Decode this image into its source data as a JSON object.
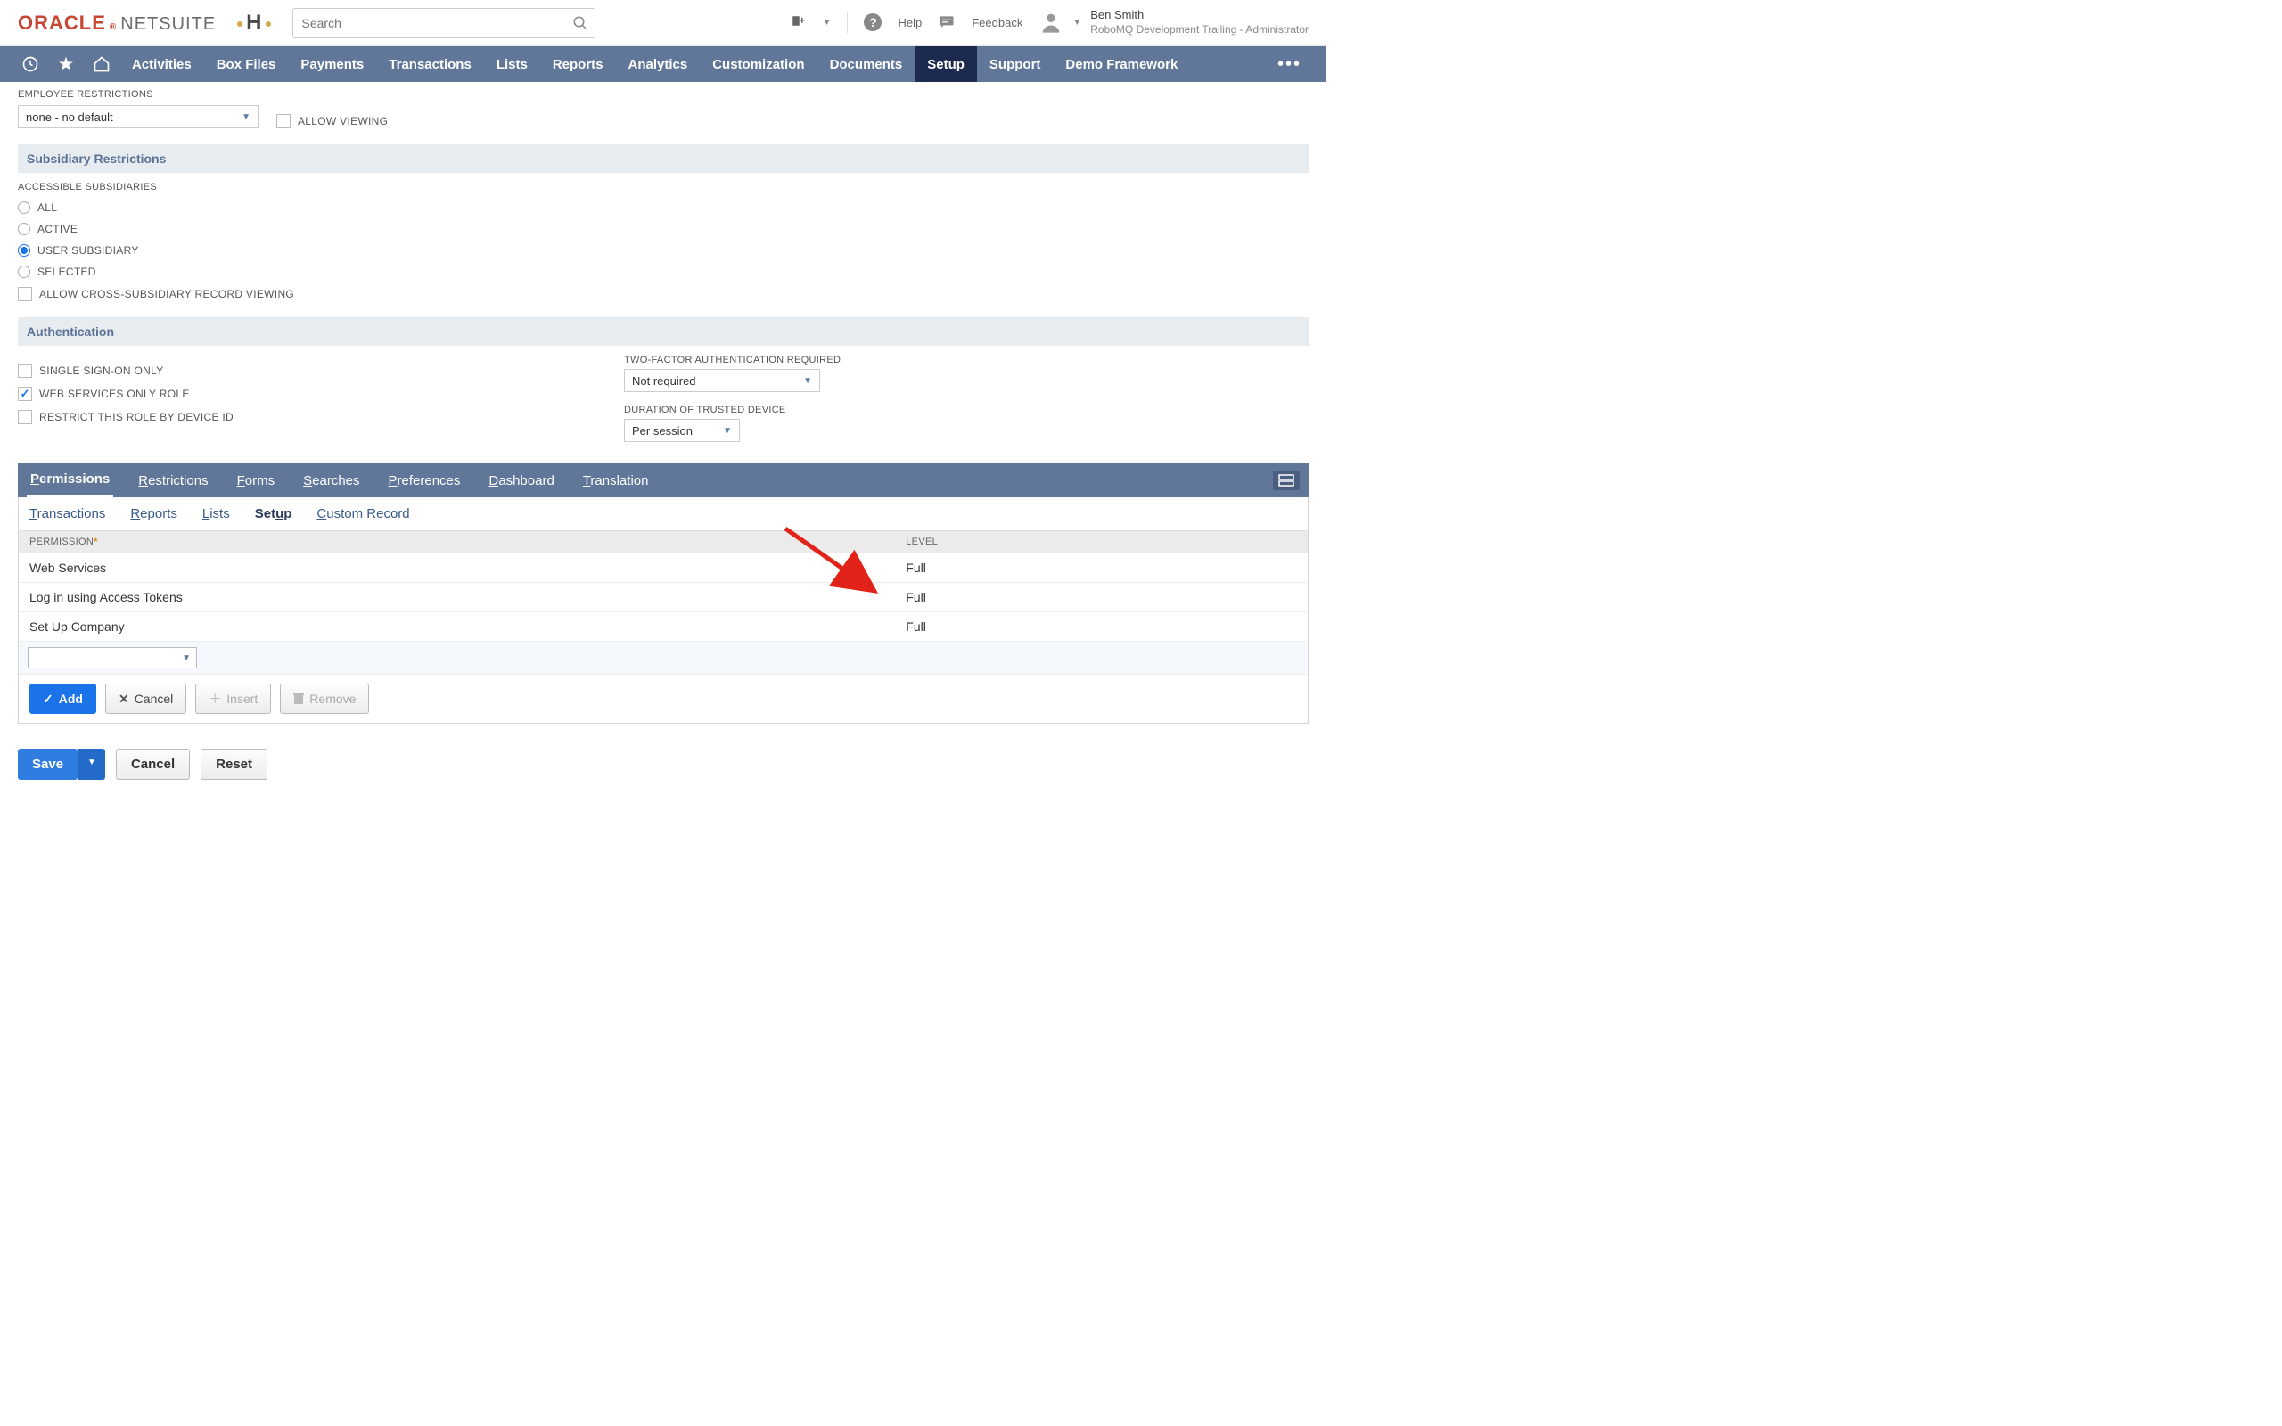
{
  "brand": {
    "oracle": "ORACLE",
    "netsuite": "NETSUITE"
  },
  "search": {
    "placeholder": "Search"
  },
  "topbar": {
    "help": "Help",
    "feedback": "Feedback",
    "user_name": "Ben Smith",
    "user_role": "RoboMQ Development Trailing - Administrator"
  },
  "nav": {
    "items": [
      "Activities",
      "Box Files",
      "Payments",
      "Transactions",
      "Lists",
      "Reports",
      "Analytics",
      "Customization",
      "Documents",
      "Setup",
      "Support",
      "Demo Framework"
    ],
    "active": "Setup"
  },
  "employee_restrictions": {
    "label": "EMPLOYEE RESTRICTIONS",
    "value": "none - no default",
    "allow_viewing_label": "ALLOW VIEWING",
    "allow_viewing_checked": false
  },
  "subsidiary": {
    "header": "Subsidiary Restrictions",
    "accessible_label": "ACCESSIBLE SUBSIDIARIES",
    "options": [
      {
        "label": "ALL",
        "checked": false
      },
      {
        "label": "ACTIVE",
        "checked": false
      },
      {
        "label": "USER SUBSIDIARY",
        "checked": true
      },
      {
        "label": "SELECTED",
        "checked": false
      }
    ],
    "cross_label": "ALLOW CROSS-SUBSIDIARY RECORD VIEWING",
    "cross_checked": false
  },
  "auth": {
    "header": "Authentication",
    "left": [
      {
        "label": "SINGLE SIGN-ON ONLY",
        "checked": false
      },
      {
        "label": "WEB SERVICES ONLY ROLE",
        "checked": true
      },
      {
        "label": "RESTRICT THIS ROLE BY DEVICE ID",
        "checked": false
      }
    ],
    "tfa_label": "TWO-FACTOR AUTHENTICATION REQUIRED",
    "tfa_value": "Not required",
    "duration_label": "DURATION OF TRUSTED DEVICE",
    "duration_value": "Per session"
  },
  "subtabs": [
    "Permissions",
    "Restrictions",
    "Forms",
    "Searches",
    "Preferences",
    "Dashboard",
    "Translation"
  ],
  "subtab_active": "Permissions",
  "inner_tabs": [
    "Transactions",
    "Reports",
    "Lists",
    "Setup",
    "Custom Record"
  ],
  "inner_tab_active": "Setup",
  "perm_table": {
    "col_permission": "PERMISSION",
    "col_level": "LEVEL",
    "rows": [
      {
        "permission": "Web Services",
        "level": "Full"
      },
      {
        "permission": "Log in using Access Tokens",
        "level": "Full"
      },
      {
        "permission": "Set Up Company",
        "level": "Full"
      }
    ]
  },
  "row_buttons": {
    "add": "Add",
    "cancel": "Cancel",
    "insert": "Insert",
    "remove": "Remove"
  },
  "footer": {
    "save": "Save",
    "cancel": "Cancel",
    "reset": "Reset"
  }
}
